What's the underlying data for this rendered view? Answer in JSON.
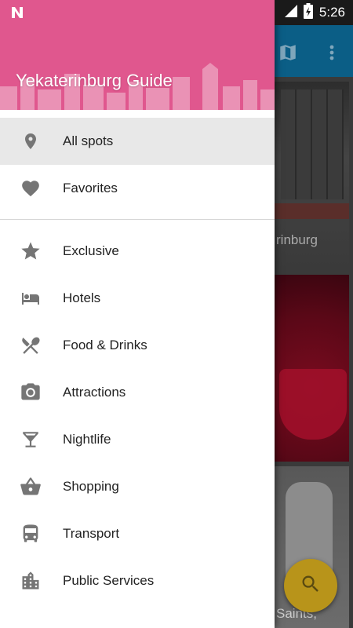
{
  "status_bar": {
    "time": "5:26",
    "notification_icon": "n-logo-icon",
    "signal_icon": "signal-icon",
    "battery_icon": "battery-charging-icon"
  },
  "drawer": {
    "title": "Yekaterinburg Guide",
    "header_color": "#e0578e",
    "primary_items": [
      {
        "label": "All spots",
        "icon": "location-pin-icon",
        "selected": true
      },
      {
        "label": "Favorites",
        "icon": "heart-icon",
        "selected": false
      }
    ],
    "category_items": [
      {
        "label": "Exclusive",
        "icon": "star-icon"
      },
      {
        "label": "Hotels",
        "icon": "bed-icon"
      },
      {
        "label": "Food & Drinks",
        "icon": "utensils-icon"
      },
      {
        "label": "Attractions",
        "icon": "camera-icon"
      },
      {
        "label": "Nightlife",
        "icon": "cocktail-icon"
      },
      {
        "label": "Shopping",
        "icon": "basket-icon"
      },
      {
        "label": "Transport",
        "icon": "bus-icon"
      },
      {
        "label": "Public Services",
        "icon": "building-icon"
      }
    ]
  },
  "background_app": {
    "toolbar_color": "#0b5e86",
    "card1_label": "rinburg",
    "card3_label": "Saints,",
    "fab_icon": "search-icon",
    "fab_color": "#b8941a"
  }
}
